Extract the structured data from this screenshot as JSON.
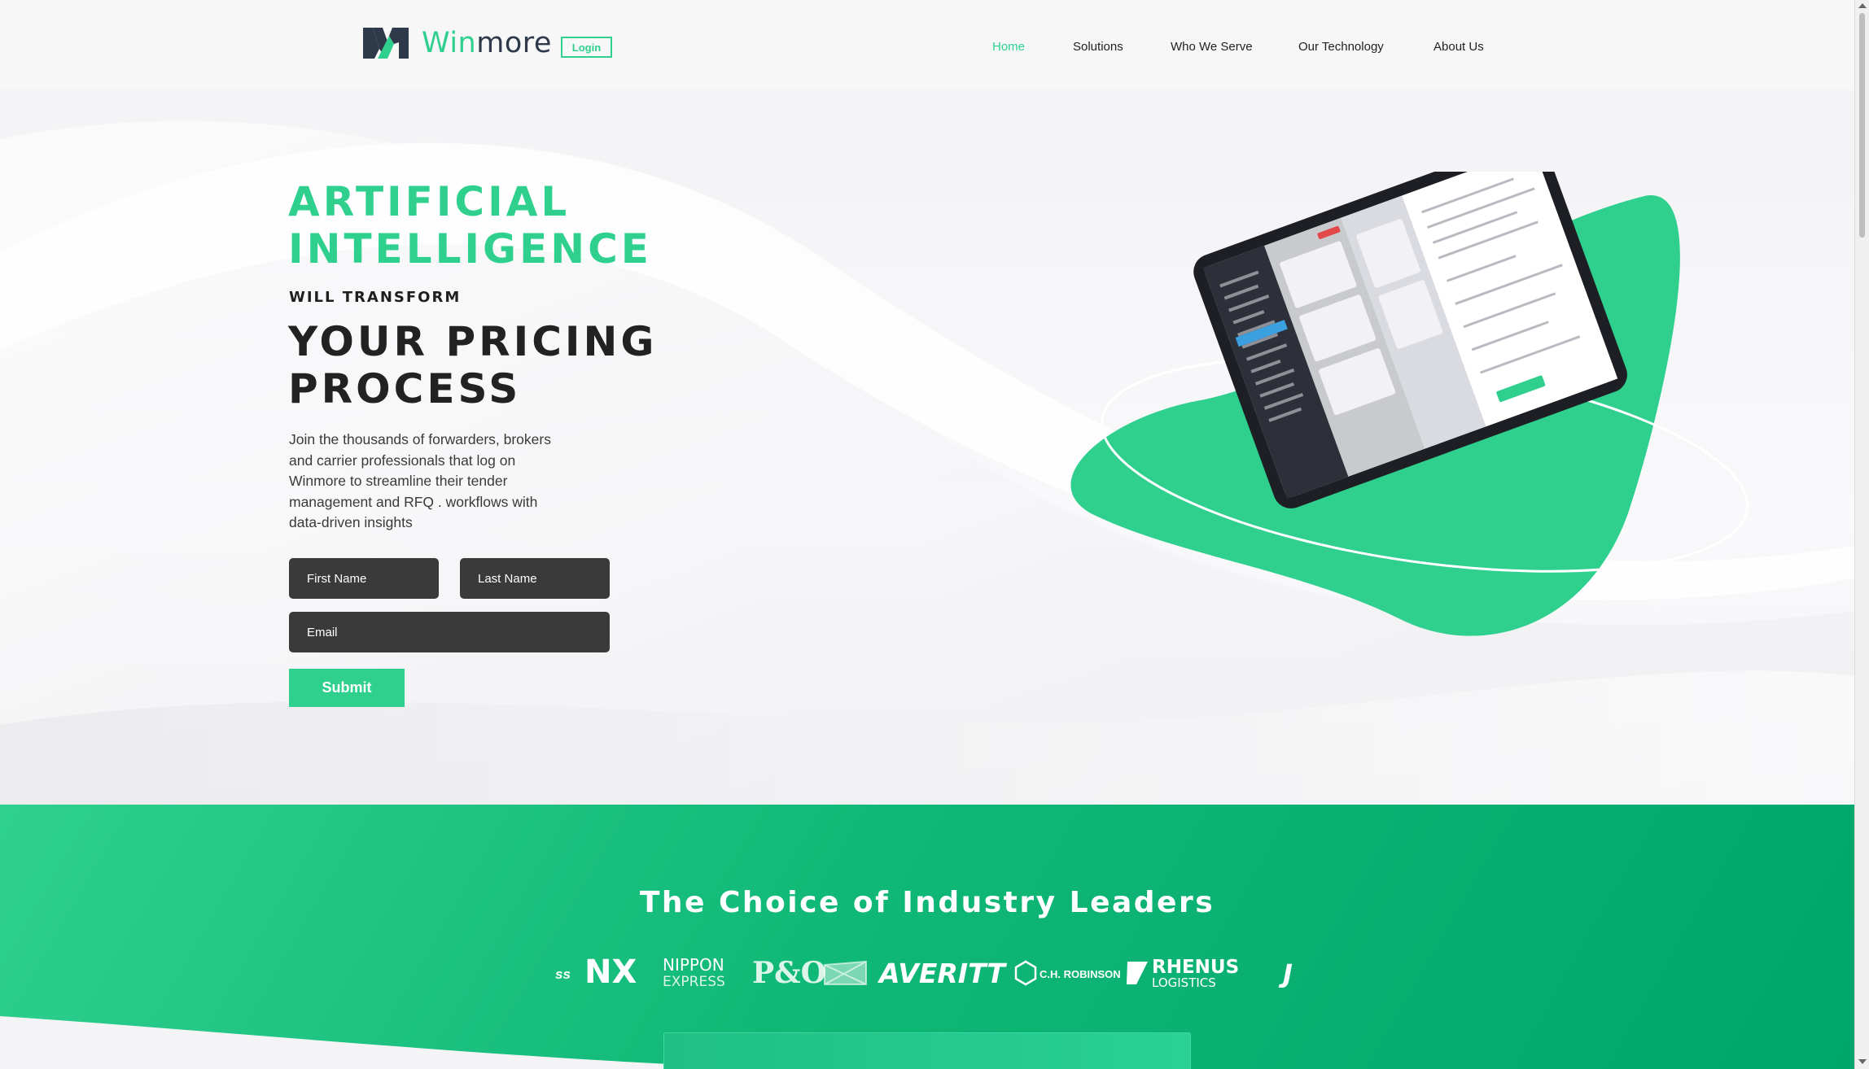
{
  "header": {
    "logo": {
      "win": "Win",
      "more": "more"
    },
    "login_label": "Login",
    "nav": [
      {
        "label": "Home",
        "active": true
      },
      {
        "label": "Solutions",
        "active": false
      },
      {
        "label": "Who We Serve",
        "active": false
      },
      {
        "label": "Our Technology",
        "active": false
      },
      {
        "label": "About Us",
        "active": false
      }
    ]
  },
  "hero": {
    "headline_green_1": "ARTIFICIAL",
    "headline_green_2": "INTELLIGENCE",
    "subheadline": "WILL TRANSFORM",
    "headline_dark_1": "YOUR PRICING",
    "headline_dark_2": "PROCESS",
    "paragraph": "Join the thousands of forwarders, brokers and carrier professionals that log on Winmore to streamline their tender management and RFQ . workflows with data-driven insights",
    "form": {
      "first_name_placeholder": "First Name",
      "last_name_placeholder": "Last Name",
      "email_placeholder": "Email",
      "submit_label": "Submit"
    }
  },
  "industry": {
    "title": "The Choice of Industry Leaders",
    "logos": [
      {
        "name": "partial-left",
        "text": "ss"
      },
      {
        "name": "nippon-express",
        "text_1": "NX",
        "text_2": "NIPPON",
        "text_3": "EXPRESS"
      },
      {
        "name": "p-and-o",
        "text": "P&O"
      },
      {
        "name": "averitt",
        "text": "AVERITT"
      },
      {
        "name": "ch-robinson",
        "text": "C.H. ROBINSON"
      },
      {
        "name": "rhenus",
        "text_1": "RHENUS",
        "text_2": "LOGISTICS"
      },
      {
        "name": "partial-right",
        "text": "J"
      }
    ]
  },
  "colors": {
    "accent": "#2fd08e",
    "dark_field": "#3a3a3a",
    "band_dark": "#00a56b"
  }
}
